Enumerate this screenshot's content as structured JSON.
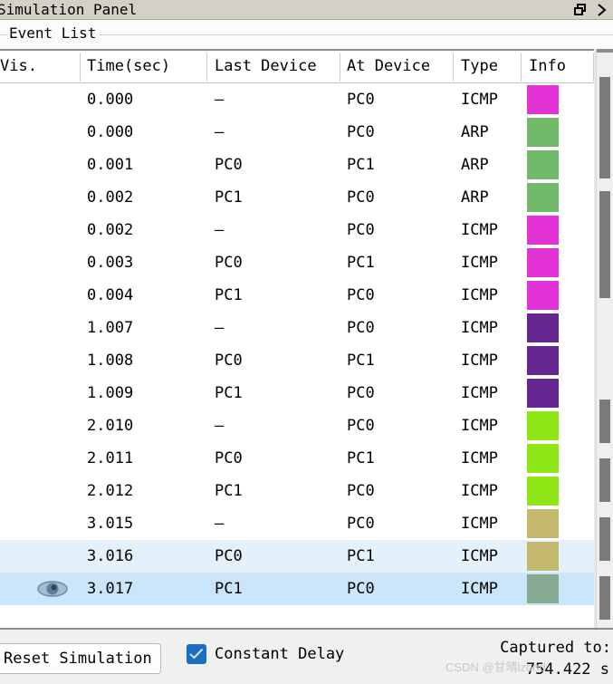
{
  "window": {
    "title": "Simulation Panel",
    "restore_icon": "restore-window-icon",
    "close_icon": "close-window-icon"
  },
  "panel": {
    "group_title": "Event List"
  },
  "table": {
    "columns": [
      "Vis.",
      "Time(sec)",
      "Last Device",
      "At Device",
      "Type",
      "Info"
    ],
    "rows": [
      {
        "vis": "",
        "time": "0.000",
        "last": "—",
        "at": "PC0",
        "type": "ICMP",
        "color": "#e234d6",
        "selected": "none"
      },
      {
        "vis": "",
        "time": "0.000",
        "last": "—",
        "at": "PC0",
        "type": "ARP",
        "color": "#73b96a",
        "selected": "none"
      },
      {
        "vis": "",
        "time": "0.001",
        "last": "PC0",
        "at": "PC1",
        "type": "ARP",
        "color": "#73b96a",
        "selected": "none"
      },
      {
        "vis": "",
        "time": "0.002",
        "last": "PC1",
        "at": "PC0",
        "type": "ARP",
        "color": "#73b96a",
        "selected": "none"
      },
      {
        "vis": "",
        "time": "0.002",
        "last": "—",
        "at": "PC0",
        "type": "ICMP",
        "color": "#e234d6",
        "selected": "none"
      },
      {
        "vis": "",
        "time": "0.003",
        "last": "PC0",
        "at": "PC1",
        "type": "ICMP",
        "color": "#e234d6",
        "selected": "none"
      },
      {
        "vis": "",
        "time": "0.004",
        "last": "PC1",
        "at": "PC0",
        "type": "ICMP",
        "color": "#e234d6",
        "selected": "none"
      },
      {
        "vis": "",
        "time": "1.007",
        "last": "—",
        "at": "PC0",
        "type": "ICMP",
        "color": "#63278f",
        "selected": "none"
      },
      {
        "vis": "",
        "time": "1.008",
        "last": "PC0",
        "at": "PC1",
        "type": "ICMP",
        "color": "#63278f",
        "selected": "none"
      },
      {
        "vis": "",
        "time": "1.009",
        "last": "PC1",
        "at": "PC0",
        "type": "ICMP",
        "color": "#63278f",
        "selected": "none"
      },
      {
        "vis": "",
        "time": "2.010",
        "last": "—",
        "at": "PC0",
        "type": "ICMP",
        "color": "#8ee617",
        "selected": "none"
      },
      {
        "vis": "",
        "time": "2.011",
        "last": "PC0",
        "at": "PC1",
        "type": "ICMP",
        "color": "#8ee617",
        "selected": "none"
      },
      {
        "vis": "",
        "time": "2.012",
        "last": "PC1",
        "at": "PC0",
        "type": "ICMP",
        "color": "#8ee617",
        "selected": "none"
      },
      {
        "vis": "",
        "time": "3.015",
        "last": "—",
        "at": "PC0",
        "type": "ICMP",
        "color": "#c4b86e",
        "selected": "none"
      },
      {
        "vis": "",
        "time": "3.016",
        "last": "PC0",
        "at": "PC1",
        "type": "ICMP",
        "color": "#c4b86e",
        "selected": "light"
      },
      {
        "vis": "eye-icon",
        "time": "3.017",
        "last": "PC1",
        "at": "PC0",
        "type": "ICMP",
        "color": "#88aa93",
        "selected": "dark"
      }
    ]
  },
  "bottom": {
    "reset_label": "Reset Simulation",
    "constant_delay_label": "Constant Delay",
    "constant_delay_checked": true,
    "captured_label": "Captured to:",
    "captured_value": "754.422 s"
  },
  "watermark": {
    "text": "CSDN @甘晴lzond"
  },
  "colors": {
    "titlebar_bg": "#d4d0c8",
    "selection_light": "#e4f1fb",
    "selection_dark": "#cbe6fa",
    "checkbox_blue": "#1a6fc4",
    "scrollbar_thumb": "#7b7b7b"
  }
}
